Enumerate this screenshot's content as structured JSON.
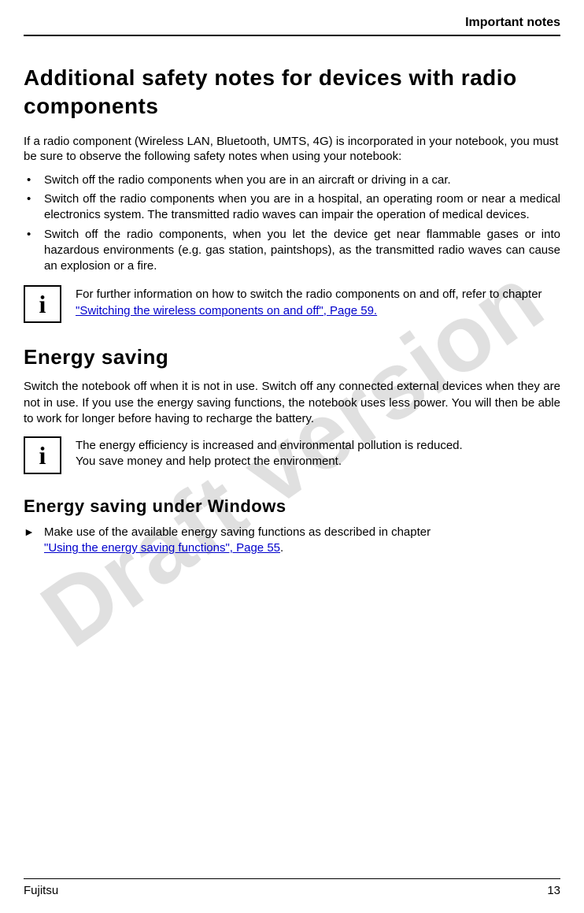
{
  "watermark": "Draft version",
  "header": {
    "section_title": "Important notes"
  },
  "section1": {
    "heading": "Additional safety notes for devices with radio components",
    "intro": "If a radio component (Wireless LAN, Bluetooth, UMTS, 4G) is incorporated in your notebook, you must be sure to observe the following safety notes when using your notebook:",
    "bullets": [
      "Switch off the radio components when you are in an aircraft or driving in a car.",
      "Switch off the radio components when you are in a hospital, an operating room or near a medical electronics system. The transmitted radio waves can impair the operation of medical devices.",
      "Switch off the radio components, when you let the device get near flammable gases or into hazardous environments (e.g. gas station, paintshops), as the transmitted radio waves can cause an explosion or a fire."
    ],
    "info": {
      "prefix": "For further information on how to switch the radio components on and off, refer to chapter ",
      "link": "\"Switching the wireless components on and off\", Page 59."
    }
  },
  "section2": {
    "heading": "Energy saving",
    "para": "Switch the notebook off when it is not in use. Switch off any connected external devices when they are not in use. If you use the energy saving functions, the notebook uses less power. You will then be able to work for longer before having to recharge the battery.",
    "info": {
      "line1": "The energy efficiency is increased and environmental pollution is reduced.",
      "line2": "You save money and help protect the environment."
    }
  },
  "section3": {
    "heading": "Energy saving under Windows",
    "action": {
      "prefix": "Make use of the available energy saving functions as described in chapter ",
      "link": "\"Using the energy saving functions\", Page 55",
      "suffix": "."
    }
  },
  "footer": {
    "brand": "Fujitsu",
    "page": "13"
  }
}
